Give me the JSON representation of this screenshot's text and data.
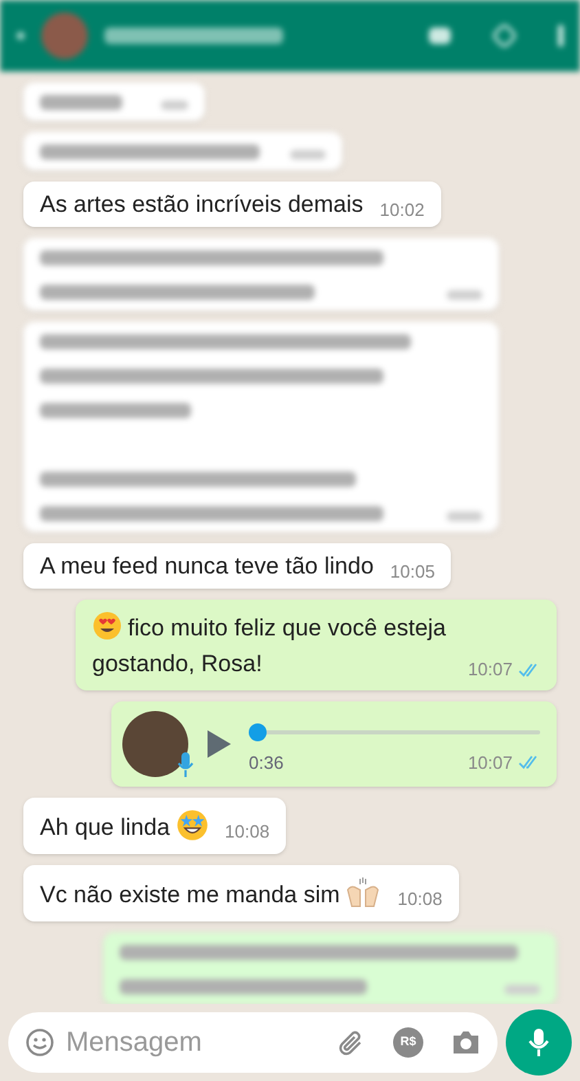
{
  "messages": [
    {
      "kind": "blurred",
      "outgoing": false
    },
    {
      "kind": "blurred",
      "outgoing": false
    },
    {
      "kind": "text",
      "outgoing": false,
      "text": "As artes estão incríveis demais",
      "time": "10:02"
    },
    {
      "kind": "blurred",
      "outgoing": false
    },
    {
      "kind": "blurred",
      "outgoing": false
    },
    {
      "kind": "text",
      "outgoing": false,
      "text": "A meu feed nunca teve tão lindo",
      "time": "10:05"
    },
    {
      "kind": "text",
      "outgoing": true,
      "text": "fico muito feliz que você esteja gostando, Rosa!",
      "time": "10:07",
      "read": true
    },
    {
      "kind": "voice",
      "outgoing": true,
      "duration": "0:36",
      "time": "10:07",
      "read": true,
      "level": 0
    },
    {
      "kind": "text",
      "outgoing": false,
      "text": "Ah que linda",
      "time": "10:08"
    },
    {
      "kind": "text",
      "outgoing": false,
      "text": "Vc não existe me manda sim",
      "time": "10:08"
    },
    {
      "kind": "blurred",
      "outgoing": true
    }
  ],
  "composer": {
    "placeholder": "Mensagem",
    "currency_label": "R$"
  }
}
